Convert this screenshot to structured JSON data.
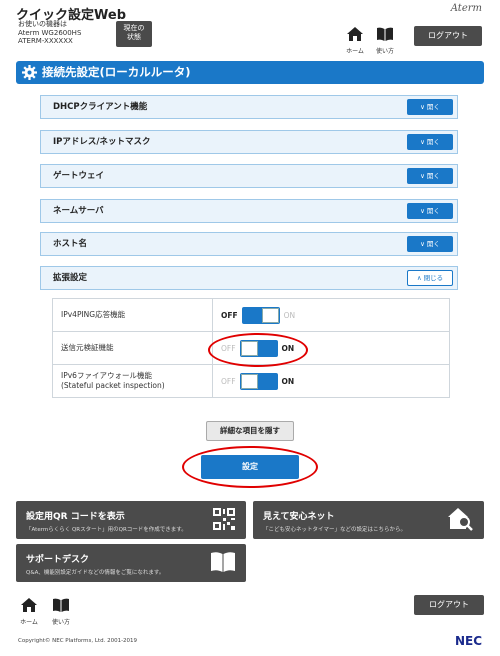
{
  "header": {
    "app_title": "クイック設定Web",
    "model_line1": "お使いの機器は",
    "model_line2": "Aterm WG2600HS",
    "model_line3": "ATERM-XXXXXX",
    "status_button": "現在の状態",
    "brand": "Aterm",
    "home_label": "ホーム",
    "help_label": "使い方",
    "logout_label": "ログアウト"
  },
  "section": {
    "title": "接続先設定(ローカルルータ)"
  },
  "accordion": [
    {
      "label": "DHCPクライアント機能",
      "button": "開く"
    },
    {
      "label": "IPアドレス/ネットマスク",
      "button": "開く"
    },
    {
      "label": "ゲートウェイ",
      "button": "開く"
    },
    {
      "label": "ネームサーバ",
      "button": "開く"
    },
    {
      "label": "ホスト名",
      "button": "開く"
    },
    {
      "label": "拡張設定",
      "button": "閉じる"
    }
  ],
  "settings": [
    {
      "label": "IPv4PING応答機能",
      "state": "OFF",
      "off": "OFF",
      "on": "ON"
    },
    {
      "label": "送信元検証機能",
      "state": "ON",
      "off": "OFF",
      "on": "ON"
    },
    {
      "label_line1": "IPv6ファイアウォール機能",
      "label_line2": "(Stateful packet inspection)",
      "state": "ON",
      "off": "OFF",
      "on": "ON"
    }
  ],
  "buttons": {
    "hide_details": "詳細な項目を隠す",
    "submit": "設定"
  },
  "tiles": [
    {
      "title": "設定用QR コードを表示",
      "desc": "「Atermらくらく QRスタート」用のQRコードを作成できます。",
      "icon": "qr-code-icon"
    },
    {
      "title": "見えて安心ネット",
      "desc": "「こども安心ネットタイマー」などの設定はこちらから。",
      "icon": "home-search-icon"
    },
    {
      "title": "サポートデスク",
      "desc": "Q&A、機能別設定ガイドなどの情報をご覧になれます。",
      "icon": "book-icon"
    }
  ],
  "footer": {
    "home_label": "ホーム",
    "help_label": "使い方",
    "logout_label": "ログアウト",
    "copyright": "Copyright© NEC Platforms, Ltd. 2001-2019",
    "nec": "NEC"
  },
  "colors": {
    "accent": "#1a78c8",
    "dark_button": "#4b4b4b",
    "highlight": "#e00000"
  }
}
